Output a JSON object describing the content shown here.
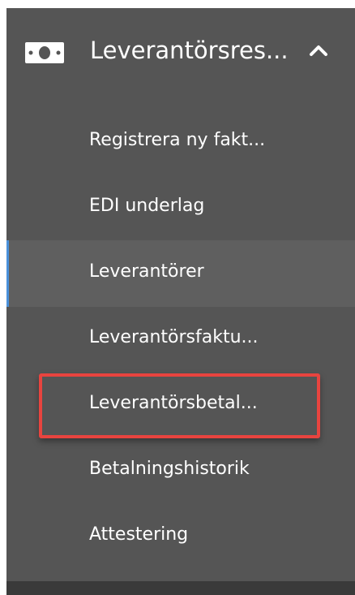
{
  "sidebar": {
    "section": {
      "icon": "money-bill-icon",
      "label": "Leverantörsres...",
      "chevron": "chevron-up-icon",
      "expanded": true
    },
    "items": [
      {
        "label": "Registrera ny fakt..."
      },
      {
        "label": "EDI underlag"
      },
      {
        "label": "Leverantörer",
        "active": true
      },
      {
        "label": "Leverantörsfaktu..."
      },
      {
        "label": "Leverantörsbetal...",
        "highlighted": true
      },
      {
        "label": "Betalningshistorik"
      },
      {
        "label": "Attestering"
      }
    ]
  },
  "colors": {
    "sidebar_bg": "#555555",
    "active_bg": "#5f5f5f",
    "active_accent": "#4a90d9",
    "highlight_border": "#e8443f",
    "text": "#ffffff"
  }
}
